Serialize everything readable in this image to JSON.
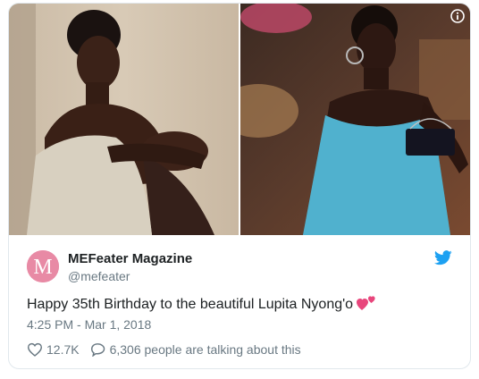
{
  "tweet": {
    "account_name": "MEFeater Magazine",
    "handle": "@mefeater",
    "avatar_letter": "M",
    "text": "Happy 35th Birthday to the beautiful Lupita Nyong'o",
    "timestamp": "4:25 PM - Mar 1, 2018",
    "likes": "12.7K",
    "conversation": "6,306 people are talking about this"
  },
  "icons": {
    "info": "info-icon",
    "bird": "twitter-bird-icon",
    "heart": "heart-icon",
    "reply": "comment-bubble-icon",
    "emoji": "two-hearts-emoji"
  },
  "colors": {
    "brand_blue": "#1da1f2",
    "avatar_pink": "#e88aa5",
    "muted_text": "#697882",
    "emoji_pink": "#e8467c"
  }
}
